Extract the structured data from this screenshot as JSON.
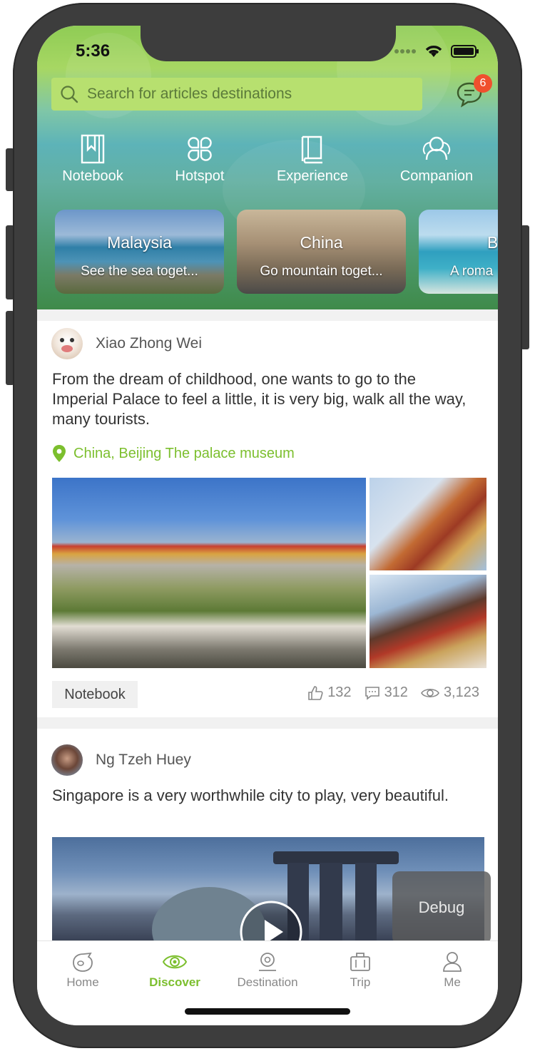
{
  "status": {
    "time": "5:36"
  },
  "search": {
    "placeholder": "Search for articles destinations"
  },
  "messages": {
    "badge": "6",
    "icon": "chat-bubble-icon"
  },
  "categories": [
    {
      "label": "Notebook",
      "icon": "bookmark-book-icon"
    },
    {
      "label": "Hotspot",
      "icon": "clover-icon"
    },
    {
      "label": "Experience",
      "icon": "book-icon"
    },
    {
      "label": "Companion",
      "icon": "people-icon"
    }
  ],
  "destinations": [
    {
      "title": "Malaysia",
      "subtitle": "See the sea toget..."
    },
    {
      "title": "China",
      "subtitle": "Go mountain toget..."
    },
    {
      "title": "B",
      "subtitle": "A roma"
    }
  ],
  "posts": [
    {
      "author": "Xiao Zhong Wei",
      "text": "From the dream of childhood, one wants to go to the Imperial Palace to feel a little, it is very big, walk all the way, many tourists.",
      "location": "China, Beijing The palace museum",
      "tag": "Notebook",
      "likes": "132",
      "comments": "312",
      "views": "3,123"
    },
    {
      "author": "Ng Tzeh Huey",
      "text": "Singapore is a very worthwhile city to play, very beautiful."
    }
  ],
  "debug": {
    "label": "Debug"
  },
  "tabs": [
    {
      "label": "Home",
      "icon": "home-icon"
    },
    {
      "label": "Discover",
      "icon": "eye-icon"
    },
    {
      "label": "Destination",
      "icon": "location-pin-icon"
    },
    {
      "label": "Trip",
      "icon": "suitcase-icon"
    },
    {
      "label": "Me",
      "icon": "person-icon"
    }
  ],
  "colors": {
    "accent": "#7cbf2e",
    "badge": "#f0502e"
  }
}
